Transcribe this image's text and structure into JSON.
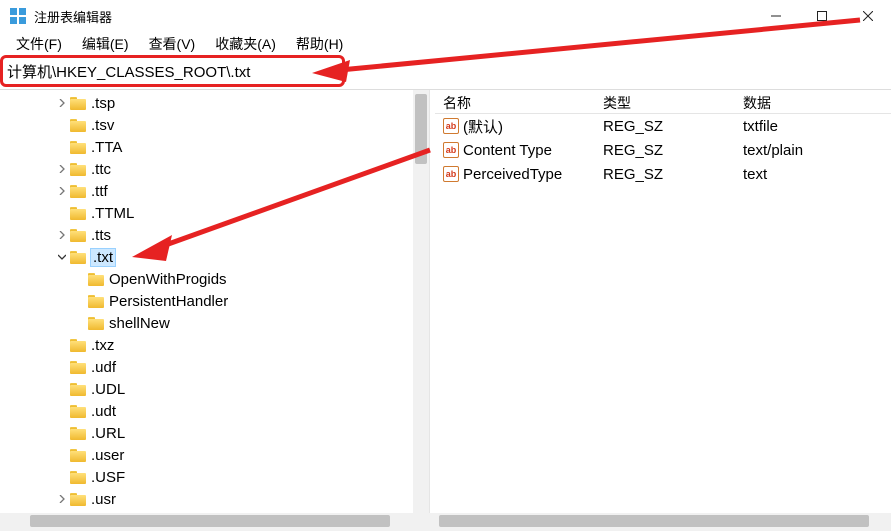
{
  "window": {
    "title": "注册表编辑器"
  },
  "menu": {
    "file": "文件(F)",
    "edit": "编辑(E)",
    "view": "查看(V)",
    "favorites": "收藏夹(A)",
    "help": "帮助(H)"
  },
  "address": {
    "path": "计算机\\HKEY_CLASSES_ROOT\\.txt"
  },
  "tree": {
    "items": [
      {
        "label": ".tsp",
        "depth": 2,
        "expander": ">"
      },
      {
        "label": ".tsv",
        "depth": 2,
        "expander": ""
      },
      {
        "label": ".TTA",
        "depth": 2,
        "expander": ""
      },
      {
        "label": ".ttc",
        "depth": 2,
        "expander": ">"
      },
      {
        "label": ".ttf",
        "depth": 2,
        "expander": ">"
      },
      {
        "label": ".TTML",
        "depth": 2,
        "expander": ""
      },
      {
        "label": ".tts",
        "depth": 2,
        "expander": ">"
      },
      {
        "label": ".txt",
        "depth": 2,
        "expander": "v",
        "selected": true
      },
      {
        "label": "OpenWithProgids",
        "depth": 3,
        "expander": ""
      },
      {
        "label": "PersistentHandler",
        "depth": 3,
        "expander": ""
      },
      {
        "label": "shellNew",
        "depth": 3,
        "expander": ""
      },
      {
        "label": ".txz",
        "depth": 2,
        "expander": ""
      },
      {
        "label": ".udf",
        "depth": 2,
        "expander": ""
      },
      {
        "label": ".UDL",
        "depth": 2,
        "expander": ""
      },
      {
        "label": ".udt",
        "depth": 2,
        "expander": ""
      },
      {
        "label": ".URL",
        "depth": 2,
        "expander": ""
      },
      {
        "label": ".user",
        "depth": 2,
        "expander": ""
      },
      {
        "label": ".USF",
        "depth": 2,
        "expander": ""
      },
      {
        "label": ".usr",
        "depth": 2,
        "expander": ">"
      }
    ]
  },
  "columns": {
    "name": "名称",
    "type": "类型",
    "data": "数据"
  },
  "values": [
    {
      "name": "(默认)",
      "type": "REG_SZ",
      "data": "txtfile"
    },
    {
      "name": "Content Type",
      "type": "REG_SZ",
      "data": "text/plain"
    },
    {
      "name": "PerceivedType",
      "type": "REG_SZ",
      "data": "text"
    }
  ],
  "icons": {
    "ab": "ab"
  }
}
